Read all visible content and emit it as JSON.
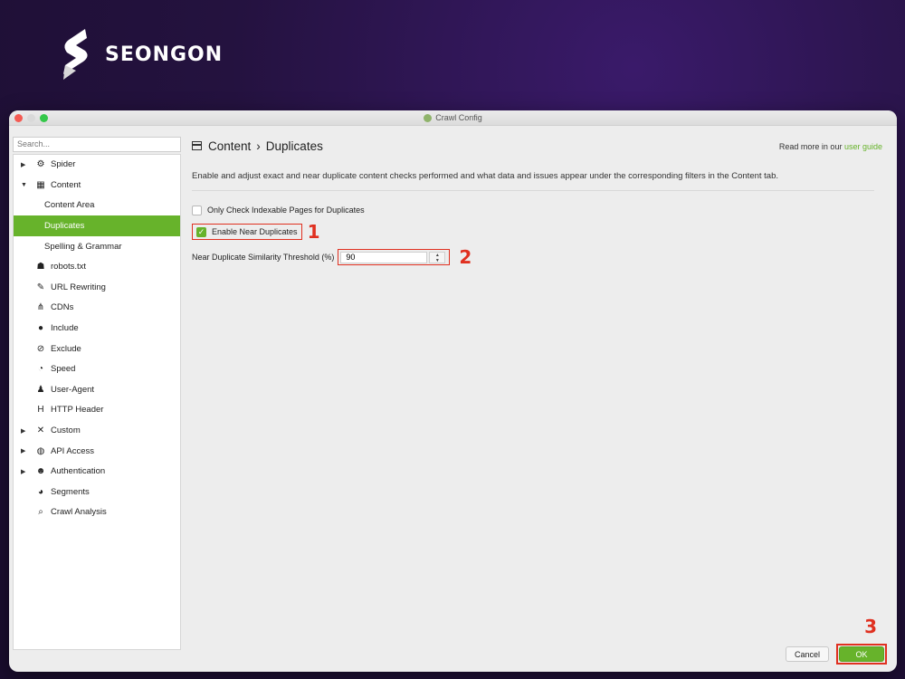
{
  "brand": {
    "name": "SEONGON"
  },
  "window": {
    "title": "Crawl Config"
  },
  "search": {
    "placeholder": "Search..."
  },
  "sidebar": {
    "items": [
      {
        "label": "Spider",
        "icon": "gear-icon",
        "expander": "collapsed"
      },
      {
        "label": "Content",
        "icon": "table-icon",
        "expander": "expanded"
      },
      {
        "label": "Content Area",
        "sub": true
      },
      {
        "label": "Duplicates",
        "sub": true,
        "active": true
      },
      {
        "label": "Spelling & Grammar",
        "sub": true
      },
      {
        "label": "robots.txt",
        "icon": "robot-icon"
      },
      {
        "label": "URL Rewriting",
        "icon": "edit-icon"
      },
      {
        "label": "CDNs",
        "icon": "network-icon"
      },
      {
        "label": "Include",
        "icon": "check-circle-icon"
      },
      {
        "label": "Exclude",
        "icon": "block-icon"
      },
      {
        "label": "Speed",
        "icon": "speedometer-icon"
      },
      {
        "label": "User-Agent",
        "icon": "user-secret-icon"
      },
      {
        "label": "HTTP Header",
        "icon": "header-icon"
      },
      {
        "label": "Custom",
        "icon": "tools-icon",
        "expander": "collapsed"
      },
      {
        "label": "API Access",
        "icon": "globe-icon",
        "expander": "collapsed"
      },
      {
        "label": "Authentication",
        "icon": "users-icon",
        "expander": "collapsed"
      },
      {
        "label": "Segments",
        "icon": "pie-chart-icon"
      },
      {
        "label": "Crawl Analysis",
        "icon": "search-icon"
      }
    ]
  },
  "main": {
    "breadcrumb_section": "Content",
    "breadcrumb_sep": "›",
    "breadcrumb_page": "Duplicates",
    "readmore_prefix": "Read more in our",
    "readmore_link": "user guide",
    "description": "Enable and adjust exact and near duplicate content checks performed and what data and issues appear under the corresponding filters in the Content tab.",
    "opt_indexable_label": "Only Check Indexable Pages for Duplicates",
    "opt_indexable_checked": false,
    "opt_near_label": "Enable Near Duplicates",
    "opt_near_checked": true,
    "threshold_label": "Near Duplicate Similarity Threshold (%)",
    "threshold_value": "90"
  },
  "annotations": {
    "one": "1",
    "two": "2",
    "three": "3"
  },
  "footer": {
    "cancel_label": "Cancel",
    "ok_label": "OK"
  },
  "colors": {
    "accent": "#67b32b",
    "annotation": "#e03020"
  }
}
